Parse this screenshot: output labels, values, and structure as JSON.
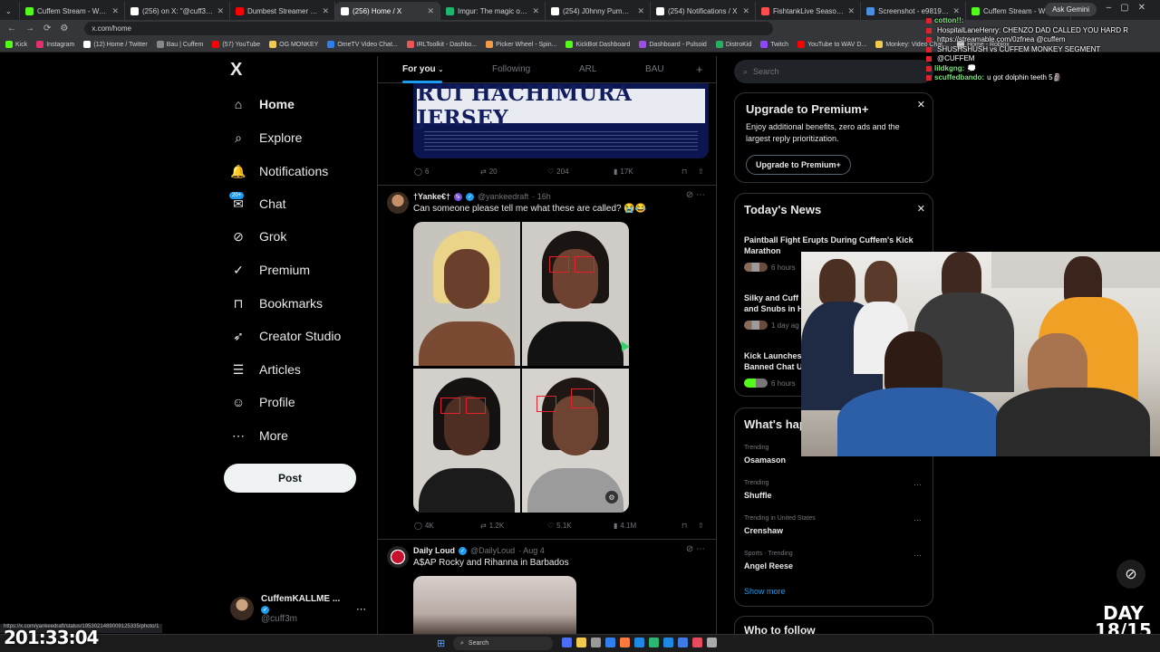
{
  "browser": {
    "tabs": [
      {
        "title": "Cuffem Stream - Watch Liv",
        "color": "#53fc18"
      },
      {
        "title": "(256) on X: \"@cuff3m mig",
        "color": "#ffffff"
      },
      {
        "title": "Dumbest Streamer Ever Ba",
        "color": "#ff0000"
      },
      {
        "title": "(256) Home / X",
        "color": "#ffffff",
        "active": true
      },
      {
        "title": "Imgur: The magic of the In",
        "color": "#1bb76e"
      },
      {
        "title": "(254) J0hnny PumP on X: \"",
        "color": "#ffffff"
      },
      {
        "title": "(254) Notifications / X",
        "color": "#ffffff"
      },
      {
        "title": "FishtankLive Season 4 | Fre",
        "color": "#ff4d4d"
      },
      {
        "title": "Screenshot - e9819fdc389",
        "color": "#4a90e2"
      },
      {
        "title": "Cuffem Stream - Watch Li",
        "color": "#53fc18"
      }
    ],
    "ask_gemini": "Ask Gemini",
    "url": "x.com/home",
    "bookmarks": [
      {
        "label": "Kick",
        "color": "#53fc18"
      },
      {
        "label": "Instagram",
        "color": "#e1306c"
      },
      {
        "label": "(12) Home / Twitter",
        "color": "#ffffff"
      },
      {
        "label": "Bau | Cuffem",
        "color": "#888888"
      },
      {
        "label": "(57) YouTube",
        "color": "#ff0000"
      },
      {
        "label": "OG MONKEY",
        "color": "#f2c94c"
      },
      {
        "label": "OmeTV Video Chat...",
        "color": "#2f80ed"
      },
      {
        "label": "IRLToolkit - Dashbo...",
        "color": "#eb5757"
      },
      {
        "label": "Picker Wheel - Spin...",
        "color": "#f2994a"
      },
      {
        "label": "KickBot Dashboard",
        "color": "#53fc18"
      },
      {
        "label": "Dashboard - Pulsoid",
        "color": "#9b51e0"
      },
      {
        "label": "DistroKid",
        "color": "#27ae60"
      },
      {
        "label": "Twitch",
        "color": "#9146ff"
      },
      {
        "label": "YouTube to WAV D...",
        "color": "#ff0000"
      },
      {
        "label": "Monkey: Video Chat...",
        "color": "#f2c94c"
      },
      {
        "label": "Home - Roblox",
        "color": "#cccccc"
      }
    ],
    "status_url": "https://x.com/yankeedraft/status/1953021489009125335/photo/1"
  },
  "nav": {
    "logo": "X",
    "items": [
      {
        "label": "Home",
        "icon": "home-icon",
        "glyph": "⌂"
      },
      {
        "label": "Explore",
        "icon": "search-icon",
        "glyph": "⌕"
      },
      {
        "label": "Notifications",
        "icon": "bell-icon",
        "glyph": "🔔"
      },
      {
        "label": "Chat",
        "icon": "chat-icon",
        "glyph": "✉"
      },
      {
        "label": "Grok",
        "icon": "grok-icon",
        "glyph": "⊘"
      },
      {
        "label": "Premium",
        "icon": "premium-icon",
        "glyph": "✓"
      },
      {
        "label": "Bookmarks",
        "icon": "bookmark-icon",
        "glyph": "⊓"
      },
      {
        "label": "Creator Studio",
        "icon": "rocket-icon",
        "glyph": "➶"
      },
      {
        "label": "Articles",
        "icon": "article-icon",
        "glyph": "☰"
      },
      {
        "label": "Profile",
        "icon": "profile-icon",
        "glyph": "☺"
      },
      {
        "label": "More",
        "icon": "more-icon",
        "glyph": "⋯"
      }
    ],
    "chat_badge": "20+",
    "post_button": "Post",
    "account": {
      "name": "CuffemKALLME ...",
      "handle": "@cuff3m",
      "more": "⋯"
    }
  },
  "feed": {
    "tabs": [
      "For you",
      "Following",
      "ARL",
      "BAU",
      "+"
    ],
    "post1": {
      "image_text": "RUI HACHIMURA JERSEY",
      "replies": "6",
      "reposts": "20",
      "likes": "204",
      "views": "17K"
    },
    "post2": {
      "name": "†Yanke€†",
      "handle": "@yankeedraft",
      "time": "· 16h",
      "text": "Can someone please tell me what these are called? 😭😂",
      "replies": "4K",
      "reposts": "1.2K",
      "likes": "5.1K",
      "views": "4.1M"
    },
    "post3": {
      "name": "Daily Loud",
      "handle": "@DailyLoud",
      "time": "· Aug 4",
      "text": "A$AP Rocky and Rihanna in Barbados"
    }
  },
  "sidebar": {
    "search_placeholder": "Search",
    "premium": {
      "title": "Upgrade to Premium+",
      "desc": "Enjoy additional benefits, zero ads and the largest reply prioritization.",
      "button": "Upgrade to Premium+"
    },
    "news": {
      "title": "Today's News",
      "items": [
        {
          "headline": "Paintball Fight Erupts During Cuffem's Kick Marathon",
          "meta": "6 hours"
        },
        {
          "headline": "Silky and Cuff",
          "headline2": "and Snubs in H",
          "meta": "1 day ag"
        },
        {
          "headline": "Kick Launches",
          "headline2": "Banned Chat U",
          "meta": "6 hours"
        }
      ]
    },
    "happening": {
      "title": "What's hap",
      "trends": [
        {
          "category": "Trending",
          "name": "Osamason"
        },
        {
          "category": "Trending",
          "name": "Shuffle"
        },
        {
          "category": "Trending in United States",
          "name": "Crenshaw"
        },
        {
          "category": "Sports · Trending",
          "name": "Angel Reese"
        }
      ],
      "show_more": "Show more"
    },
    "who_to_follow": "Who to follow"
  },
  "chat": [
    {
      "user": "",
      "text": "HospitalLaneHenry: CHENZO DAD CALLED YOU HARD R"
    },
    {
      "user": "",
      "text": "https://streamable.com/0zfnea @cuffem"
    },
    {
      "user": "",
      "text": "@CUFFEM"
    },
    {
      "user": "lildkgng:",
      "text": "💭",
      "color": "#7ee07e"
    },
    {
      "user": "scuffedbando:",
      "text": "u got dolphin teeth 5🗿",
      "color": "#7ee07e"
    }
  ],
  "chat_top": [
    {
      "user": "cotton!!:",
      "text": "",
      "color": "#7ee07e"
    },
    {
      "user": "",
      "text": "SHUSHSHUSH vs CUFFEM MONKEY SEGMENT"
    }
  ],
  "overlay": {
    "timer": "201:33:04",
    "day_label": "DAY",
    "day_value": "18/15"
  },
  "taskbar": {
    "search": "Search",
    "icons": [
      "#4c6ef5",
      "#f2c94c",
      "#999999",
      "#2f80ed",
      "#ff7a3c",
      "#1e88e5",
      "#2bb673",
      "#1e88e5",
      "#3d7be6",
      "#e84a5f",
      "#aaaaaa"
    ]
  }
}
